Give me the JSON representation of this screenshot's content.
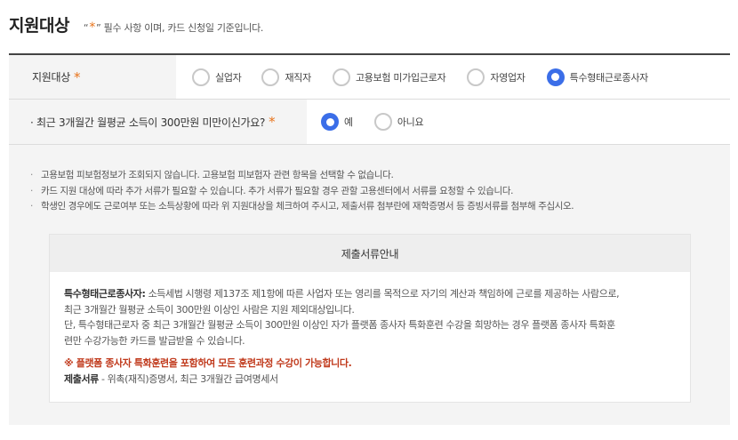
{
  "header": {
    "title": "지원대상",
    "note_open_quote": "“",
    "note_star": "*",
    "note_close_quote": "”",
    "note_text": " 필수 사항 이며, 카드 신청일 기준입니다."
  },
  "row1": {
    "label": "지원대상",
    "required": "*",
    "options": [
      {
        "label": "실업자",
        "selected": false
      },
      {
        "label": "재직자",
        "selected": false
      },
      {
        "label": "고용보험 미가입근로자",
        "selected": false
      },
      {
        "label": "자영업자",
        "selected": false
      },
      {
        "label": "특수형태근로종사자",
        "selected": true
      }
    ]
  },
  "row2": {
    "label": "· 최근 3개월간 월평균 소득이 300만원 미만이신가요?",
    "required": "*",
    "options": [
      {
        "label": "예",
        "selected": true
      },
      {
        "label": "아니요",
        "selected": false
      }
    ]
  },
  "notices": [
    "고용보험 피보험정보가 조회되지 않습니다. 고용보험 피보험자 관련 항목을 선택할 수 없습니다.",
    "카드 지원 대상에 따라 추가 서류가 필요할 수 있습니다. 추가 서류가 필요할 경우 관할 고용센터에서 서류를 요청할 수 있습니다.",
    "학생인 경우에도 근로여부 또는 소득상황에 따라 위 지원대상을 체크하여 주시고, 제출서류 첨부란에 재학증명서 등 증빙서류를 첨부해 주십시오."
  ],
  "doc_guide": {
    "heading": "제출서류안내",
    "term": "특수형태근로종사자:",
    "line1": " 소득세법 시행령 제137조 제1항에 따른 사업자 또는 영리를 목적으로 자기의 계산과 책임하에 근로를 제공하는 사람으로,",
    "line2": "최근 3개월간 월평균 소득이 300만원 이상인 사람은 지원 제외대상입니다.",
    "line3": "단, 특수형태근로자 중 최근 3개월간 월평균 소득이 300만원 이상인 자가 플랫폼 종사자 특화훈련 수강을 희망하는 경우 플랫폼 종사자 특화훈",
    "line4": "련만 수강가능한 카드를 발급받을 수 있습니다.",
    "warning": "※ 플랫폼 종사자 특화훈련을 포함하여 모든 훈련과정 수강이 가능합니다.",
    "docs_label": "제출서류",
    "docs_text": " - 위촉(재직)증명서, 최근 3개월간 급여명세서"
  },
  "colors": {
    "accent": "#3b6ee8",
    "required": "#e8731a",
    "warning": "#c0391b"
  }
}
